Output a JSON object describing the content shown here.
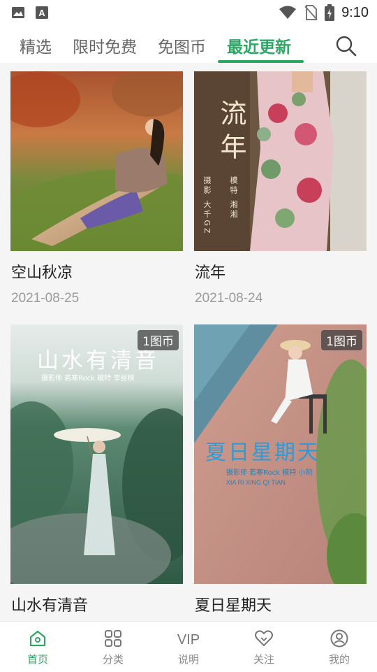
{
  "status_bar": {
    "time": "9:10",
    "icons": [
      "image-icon",
      "a-icon",
      "wifi-icon",
      "no-sim-icon",
      "battery-charging-icon"
    ]
  },
  "tabs": [
    {
      "label": "精选",
      "active": false
    },
    {
      "label": "限时免费",
      "active": false
    },
    {
      "label": "免图币",
      "active": false
    },
    {
      "label": "最近更新",
      "active": true
    }
  ],
  "search_icon": "search-icon",
  "cards": [
    {
      "title": "空山秋凉",
      "date": "2021-08-25",
      "badge": ""
    },
    {
      "title": "流年",
      "date": "2021-08-24",
      "badge": "",
      "overlay": {
        "title": "流年",
        "credit1": "摄影 大千GZ",
        "credit2": "模特 湘湘"
      }
    },
    {
      "title": "山水有清音",
      "date": "",
      "badge": "1图币",
      "overlay": {
        "title": "山水有清音",
        "credit": "摄影师 若寒Rock    模特 李丝棋"
      }
    },
    {
      "title": "夏日星期天",
      "date": "",
      "badge": "1图币",
      "overlay": {
        "title": "夏日星期天",
        "credit": "摄影师 若寒Rock    模特 小阴",
        "subtitle": "XIA RI XING QI TIAN"
      }
    }
  ],
  "bottom_nav": [
    {
      "label": "首页",
      "icon": "home-icon",
      "active": true
    },
    {
      "label": "分类",
      "icon": "grid-icon",
      "active": false
    },
    {
      "label": "说明",
      "icon": "vip-icon",
      "active": false,
      "icon_text": "VIP"
    },
    {
      "label": "关注",
      "icon": "heart-icon",
      "active": false
    },
    {
      "label": "我的",
      "icon": "user-icon",
      "active": false
    }
  ],
  "colors": {
    "accent": "#2aa864"
  }
}
